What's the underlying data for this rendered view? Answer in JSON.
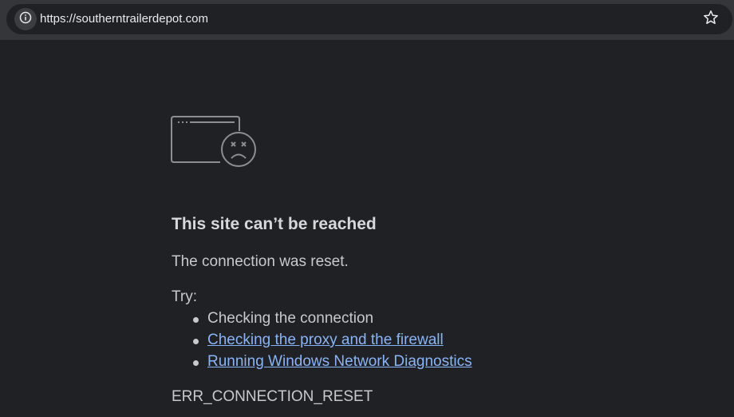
{
  "address_bar": {
    "url": "https://southerntrailerdepot.com",
    "site_info_icon": "info-icon",
    "bookmark_icon": "star-icon"
  },
  "error_page": {
    "icon": "sad-browser-window-icon",
    "title": "This site can’t be reached",
    "summary": "The connection was reset.",
    "try_label": "Try:",
    "suggestions": [
      {
        "text": "Checking the connection",
        "is_link": false
      },
      {
        "text": "Checking the proxy and the firewall",
        "is_link": true
      },
      {
        "text": "Running Windows Network Diagnostics",
        "is_link": true
      }
    ],
    "error_code": "ERR_CONNECTION_RESET"
  },
  "colors": {
    "page_background": "#202124",
    "toolbar_background": "#35363a",
    "text": "#c8c9cb",
    "heading": "#d7d8da",
    "link": "#8ab4f8"
  }
}
